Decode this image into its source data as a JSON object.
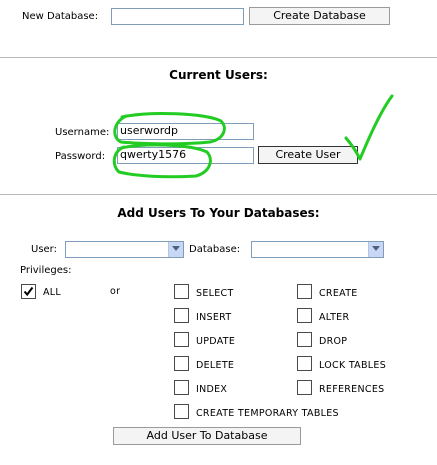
{
  "create_db": {
    "label": "New Database:",
    "input_value": "",
    "button": "Create Database"
  },
  "current_users": {
    "heading": "Current Users:",
    "username_label": "Username:",
    "username_value": "userwordp",
    "password_label": "Password:",
    "password_value": "qwerty1576",
    "button": "Create User"
  },
  "add_users": {
    "heading": "Add Users To Your Databases:",
    "user_label": "User:",
    "user_selected": "",
    "database_label": "Database:",
    "database_selected": "",
    "privileges_label": "Privileges:",
    "all_label": "ALL",
    "all_checked": true,
    "or_label": "or",
    "privileges": [
      {
        "label": "SELECT",
        "checked": false
      },
      {
        "label": "CREATE",
        "checked": false
      },
      {
        "label": "INSERT",
        "checked": false
      },
      {
        "label": "ALTER",
        "checked": false
      },
      {
        "label": "UPDATE",
        "checked": false
      },
      {
        "label": "DROP",
        "checked": false
      },
      {
        "label": "DELETE",
        "checked": false
      },
      {
        "label": "LOCK TABLES",
        "checked": false
      },
      {
        "label": "INDEX",
        "checked": false
      },
      {
        "label": "REFERENCES",
        "checked": false
      },
      {
        "label": "CREATE TEMPORARY TABLES",
        "checked": false
      }
    ],
    "submit": "Add User To Database"
  },
  "annotation_color": "#22cc22"
}
